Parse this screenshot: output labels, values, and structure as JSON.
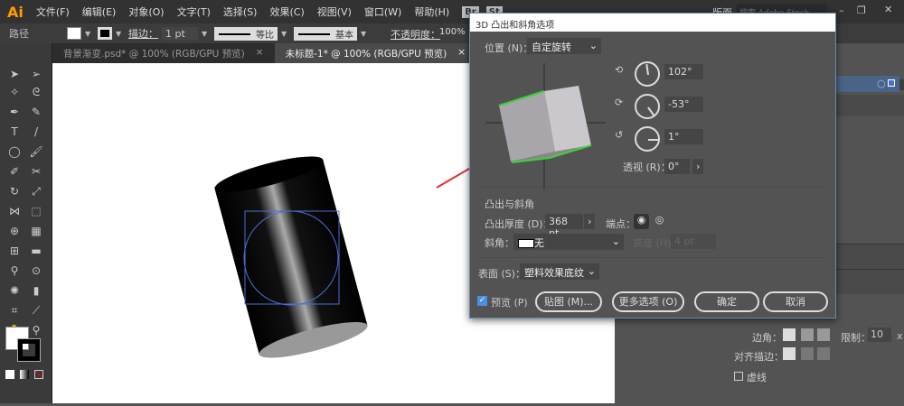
{
  "app": {
    "logo": "Ai",
    "menu": [
      "文件(F)",
      "编辑(E)",
      "对象(O)",
      "文字(T)",
      "选择(S)",
      "效果(C)",
      "视图(V)",
      "窗口(W)",
      "帮助(H)"
    ],
    "br": "Br",
    "st": "St",
    "workspace": "版面",
    "search_placeholder": "搜索 Adobe Stock"
  },
  "control": {
    "object_type": "路径",
    "stroke_label": "描边：",
    "stroke_weight": "1 pt",
    "profile": "等比",
    "brush": "基本",
    "opacity_label": "不透明度：",
    "opacity": "100%"
  },
  "tabs": [
    {
      "label": "背景渐变.psd* @ 100% (RGB/GPU 预览)",
      "close": "×"
    },
    {
      "label": "未标题-1* @ 100% (RGB/GPU 预览)",
      "close": "×"
    }
  ],
  "dialog": {
    "title": "3D 凸出和斜角选项",
    "position_label": "位置 (N)：",
    "position_value": "自定旋转",
    "rot_x": "102°",
    "rot_y": "-53°",
    "rot_z": "1°",
    "perspective_label": "透视 (R)：",
    "perspective": "0°",
    "extrude_section": "凸出与斜角",
    "depth_label": "凸出厚度 (D)：",
    "depth": "368 pt",
    "cap_label": "端点：",
    "bevel_label": "斜角：",
    "bevel_value": "无",
    "height_label": "高度 (H)：",
    "height_value": "4 pt",
    "surface_label": "表面 (S)：",
    "surface_value": "塑料效果底纹",
    "preview_label": "预览 (P)",
    "preview_checked": true,
    "map_button": "贴图 (M)...",
    "more_button": "更多选项 (O)",
    "ok_button": "确定",
    "cancel_button": "取消"
  },
  "stroke_panel": {
    "corner_label": "边角：",
    "limit_label": "限制：",
    "limit_value": "10",
    "limit_unit": "x",
    "align_label": "对齐描边：",
    "dashed_label": "虚线"
  },
  "colors": {
    "accent_green": "#3cd23c",
    "arrow_red": "#e03030",
    "selection_blue": "#4a6fd0"
  }
}
